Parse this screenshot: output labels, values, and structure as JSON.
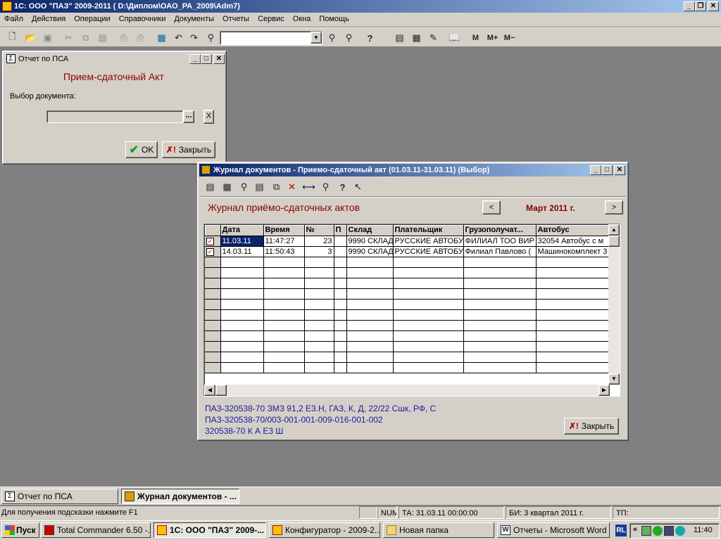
{
  "app": {
    "title": "1С: ООО \"ПАЗ\"  2009-2011 ( D:\\Диплом\\ОАО_РА_2009\\Adm7)"
  },
  "menu": [
    "Файл",
    "Действия",
    "Операции",
    "Справочники",
    "Документы",
    "Отчеты",
    "Сервис",
    "Окна",
    "Помощь"
  ],
  "toolbar": {
    "m_label": "M",
    "mplus_label": "M+",
    "mminus_label": "M−",
    "search_value": ""
  },
  "psa": {
    "title": "Отчет по ПСА",
    "heading": "Прием-сдаточный Акт",
    "doc_label": "Выбор документа:",
    "doc_value": "",
    "browse": "...",
    "clear": "X",
    "ok": "OK",
    "close": "Закрыть"
  },
  "journal": {
    "title": "Журнал документов  - Приемо-сдаточный акт (01.03.11-31.03.11) (Выбор)",
    "heading": "Журнал приёмо-сдаточных актов",
    "prev": "<",
    "next": ">",
    "period": "Март 2011 г.",
    "columns": [
      "Дата",
      "Время",
      "№",
      "П",
      "Склад",
      "Плательщик",
      "Грузополучат...",
      "Автобус"
    ],
    "rows": [
      [
        "11.03.11",
        "11:47:27",
        "23",
        "",
        "9990 СКЛАД",
        "РУССКИЕ АВТОБУ",
        "ФИЛИАЛ ТОО ВИР",
        "32054 Автобус с м"
      ],
      [
        "14.03.11",
        "11:50:43",
        "3",
        "",
        "9990 СКЛАД",
        "РУССКИЕ АВТОБУ",
        "Филиал Павлово (",
        "Машинокомплект 3"
      ]
    ],
    "info": [
      "ПАЗ-320538-70 ЗМЗ 91,2 Е3.Н, ГАЗ, К, Д, 22/22 Сшк, РФ, С",
      "ПАЗ-320538-70/003-001-001-009-016-001-002",
      "320538-70  К А Е3 Ш"
    ],
    "close": "Закрыть"
  },
  "windowbar": [
    {
      "label": "Отчет по ПСА"
    },
    {
      "label": "Журнал документов  - ..."
    }
  ],
  "statusbar": {
    "hint": "Для получения подсказки нажмите F1",
    "num": "NUM",
    "ta": "ТА: 31.03.11  00:00:00",
    "bi": "БИ: 3 квартал 2011 г.",
    "tp": "ТП:"
  },
  "taskbar": {
    "start": "Пуск",
    "items": [
      {
        "label": "Total Commander 6.50 -..."
      },
      {
        "label": "1С: ООО \"ПАЗ\"  2009-..."
      },
      {
        "label": "Конфигуратор - 2009-2..."
      },
      {
        "label": "Новая папка"
      },
      {
        "label": "Отчеты - Microsoft Word"
      }
    ],
    "lang": "RL",
    "clock": "11:40"
  }
}
